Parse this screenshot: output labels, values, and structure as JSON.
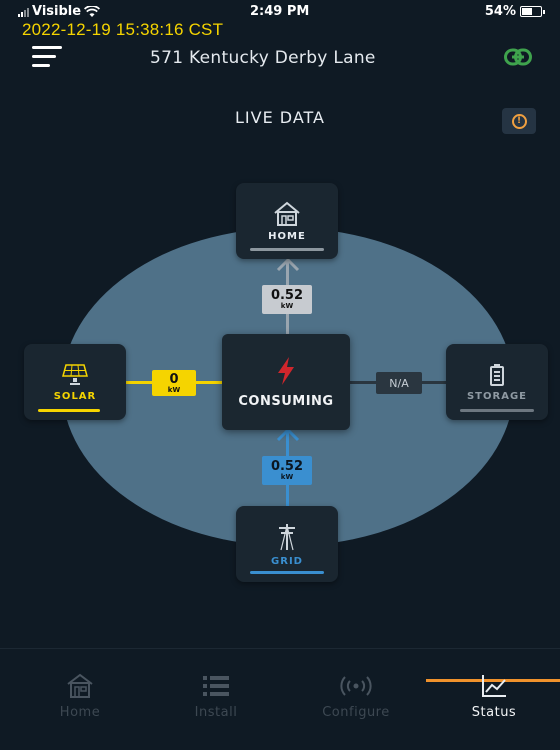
{
  "status_bar": {
    "carrier": "Visible",
    "time": "2:49 PM",
    "battery": "54%",
    "battery_level": 0.54
  },
  "timestamp_overlay": "2022-12-19 15:38:16 CST",
  "header": {
    "address": "571 Kentucky Derby Lane",
    "menu_icon": "hamburger-menu-icon",
    "link_icon": "link-icon",
    "link_color": "#3fa34d"
  },
  "live": {
    "title": "LIVE DATA",
    "info_icon": "info-icon"
  },
  "nodes": {
    "home": {
      "label": "HOME",
      "icon": "house-icon"
    },
    "solar": {
      "label": "SOLAR",
      "icon": "solar-panel-icon",
      "color": "#f5d400"
    },
    "storage": {
      "label": "STORAGE",
      "icon": "battery-icon"
    },
    "grid": {
      "label": "GRID",
      "icon": "power-tower-icon",
      "color": "#3a8fd0"
    },
    "center": {
      "label": "CONSUMING",
      "icon": "lightning-bolt-icon",
      "color": "#d0262c"
    }
  },
  "flows": {
    "home": {
      "value": "0.52",
      "unit": "kW"
    },
    "solar": {
      "value": "0",
      "unit": "kW"
    },
    "storage": {
      "value": "N/A"
    },
    "grid": {
      "value": "0.52",
      "unit": "kW"
    }
  },
  "tabs": [
    {
      "label": "Home",
      "icon": "house-icon",
      "active": false
    },
    {
      "label": "Install",
      "icon": "list-icon",
      "active": false
    },
    {
      "label": "Configure",
      "icon": "broadcast-icon",
      "active": false
    },
    {
      "label": "Status",
      "icon": "chart-line-icon",
      "active": true
    }
  ],
  "colors": {
    "accent": "#f0922c",
    "background": "#0f1a24",
    "circle": "#4f7188"
  }
}
